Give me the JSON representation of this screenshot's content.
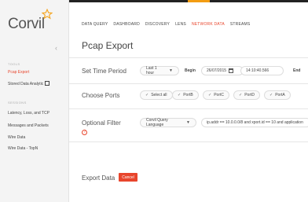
{
  "logo": {
    "text": "Corvil"
  },
  "sidebar": {
    "collapse_icon": "chevron-left-icon",
    "sections": [
      {
        "label": "TOOLS",
        "items": [
          {
            "label": "Pcap Export",
            "active": true
          },
          {
            "label": "Stored Data Analytic",
            "external": true
          }
        ]
      },
      {
        "label": "SESSIONS",
        "items": [
          {
            "label": "Latency, Loss, and TCP"
          },
          {
            "label": "Messages and Packets"
          },
          {
            "label": "Wire Data"
          },
          {
            "label": "Wire Data - TopN"
          }
        ]
      }
    ]
  },
  "topnav": {
    "items": [
      "DATA QUERY",
      "DASHBOARD",
      "DISCOVERY",
      "LENS",
      "NETWORK DATA",
      "STREAMS"
    ],
    "active": "NETWORK DATA"
  },
  "page": {
    "title": "Pcap Export"
  },
  "time_period": {
    "label": "Set Time Period",
    "range_select": "Last 1 hour",
    "begin_label": "Begin",
    "begin_date": "26/07/2015",
    "begin_time": "14:10:40.566",
    "end_label": "End"
  },
  "ports": {
    "label": "Choose Ports",
    "options": [
      "Select all",
      "PortB",
      "PortC",
      "PortD",
      "PortA"
    ]
  },
  "filter": {
    "label": "Optional Filter",
    "language_select": "Corvil Query Language",
    "value": "ip.addr == 10.0.0.0/8 and xport.id == 10 and application"
  },
  "export": {
    "label": "Export Data",
    "cancel_label": "Cancel"
  },
  "colors": {
    "accent": "#e8452c",
    "nav_underline": "#f39c12",
    "logo_star": "#f5a623"
  }
}
